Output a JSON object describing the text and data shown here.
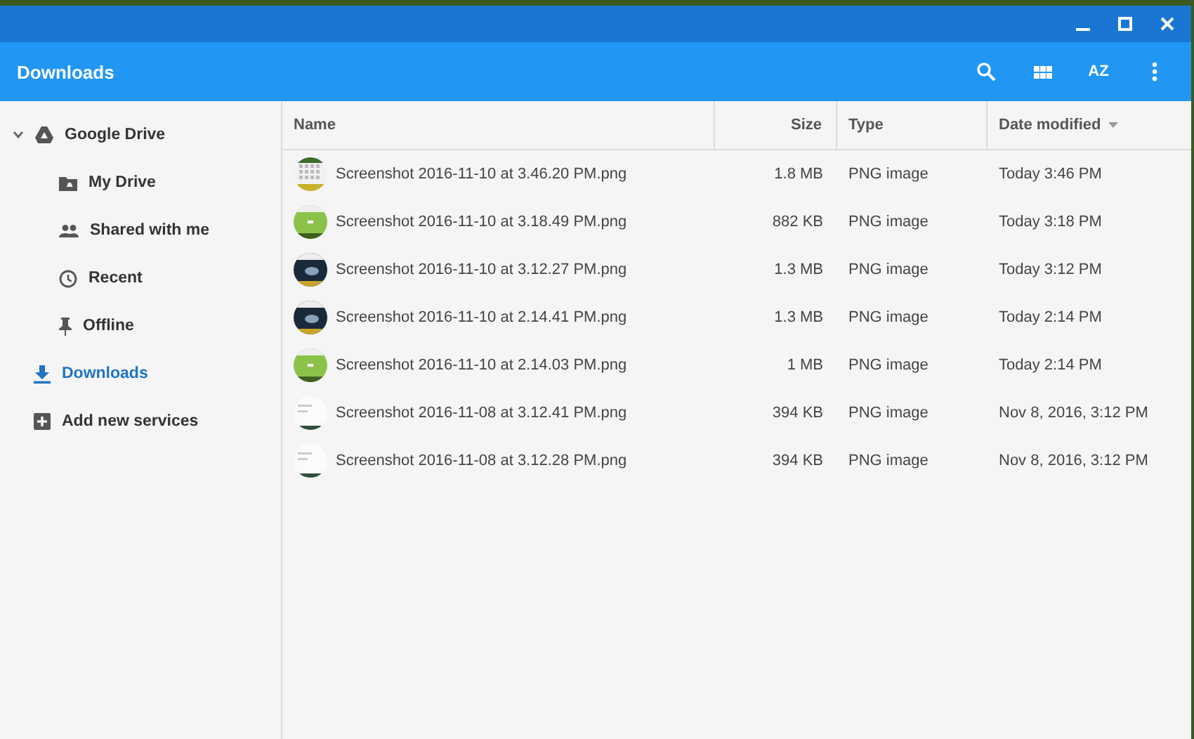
{
  "window": {
    "title": "Downloads"
  },
  "toolbar": {
    "sort_label": "AZ"
  },
  "sidebar": {
    "items": [
      {
        "label": "Google Drive",
        "expanded": true,
        "selected": false,
        "children": [
          {
            "label": "My Drive",
            "selected": false
          },
          {
            "label": "Shared with me",
            "selected": false
          },
          {
            "label": "Recent",
            "selected": false
          },
          {
            "label": "Offline",
            "selected": false
          }
        ]
      },
      {
        "label": "Downloads",
        "selected": true
      },
      {
        "label": "Add new services",
        "selected": false
      }
    ]
  },
  "table": {
    "columns": [
      {
        "label": "Name",
        "sorted": false
      },
      {
        "label": "Size",
        "sorted": false
      },
      {
        "label": "Type",
        "sorted": false
      },
      {
        "label": "Date modified",
        "sorted": true
      }
    ],
    "rows": [
      {
        "name": "Screenshot 2016-11-10 at 3.46.20 PM.png",
        "size": "1.8 MB",
        "type": "PNG image",
        "date": "Today 3:46 PM"
      },
      {
        "name": "Screenshot 2016-11-10 at 3.18.49 PM.png",
        "size": "882 KB",
        "type": "PNG image",
        "date": "Today 3:18 PM"
      },
      {
        "name": "Screenshot 2016-11-10 at 3.12.27 PM.png",
        "size": "1.3 MB",
        "type": "PNG image",
        "date": "Today 3:12 PM"
      },
      {
        "name": "Screenshot 2016-11-10 at 2.14.41 PM.png",
        "size": "1.3 MB",
        "type": "PNG image",
        "date": "Today 2:14 PM"
      },
      {
        "name": "Screenshot 2016-11-10 at 2.14.03 PM.png",
        "size": "1 MB",
        "type": "PNG image",
        "date": "Today 2:14 PM"
      },
      {
        "name": "Screenshot 2016-11-08 at 3.12.41 PM.png",
        "size": "394 KB",
        "type": "PNG image",
        "date": "Nov 8, 2016, 3:12 PM"
      },
      {
        "name": "Screenshot 2016-11-08 at 3.12.28 PM.png",
        "size": "394 KB",
        "type": "PNG image",
        "date": "Nov 8, 2016, 3:12 PM"
      }
    ]
  }
}
